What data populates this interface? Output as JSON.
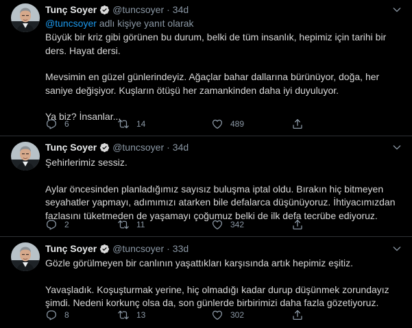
{
  "tweets": [
    {
      "name": "Tunç Soyer",
      "handle": "@tuncsoyer",
      "separator": "·",
      "time": "34d",
      "reply_mention": "@tuncsoyer",
      "reply_suffix": " adlı kişiye yanıt olarak",
      "paragraphs": [
        "Büyük bir kriz gibi görünen bu durum, belki de tüm insanlık, hepimiz için tarihi bir ders. Hayat dersi.",
        "Mevsimin en güzel günlerindeyiz. Ağaçlar bahar dallarına bürünüyor, doğa, her saniye değişiyor. Kuşların ötüşü her zamankinden daha iyi duyuluyor.",
        "Ya biz? İnsanlar..."
      ],
      "replies": "6",
      "retweets": "14",
      "likes": "489"
    },
    {
      "name": "Tunç Soyer",
      "handle": "@tuncsoyer",
      "separator": "·",
      "time": "34d",
      "paragraphs": [
        "Şehirlerimiz sessiz.",
        "Aylar öncesinden planladığımız sayısız buluşma iptal oldu. Bırakın hiç bitmeyen seyahatler yapmayı, adımımızı atarken bile defalarca düşünüyoruz. İhtiyacımızdan fazlasını tüketmeden de yaşamayı çoğumuz belki de ilk defa tecrübe ediyoruz."
      ],
      "replies": "2",
      "retweets": "11",
      "likes": "342"
    },
    {
      "name": "Tunç Soyer",
      "handle": "@tuncsoyer",
      "separator": "·",
      "time": "33d",
      "paragraphs": [
        "Gözle görülmeyen bir canlının yaşattıkları karşısında artık hepimiz eşitiz.",
        "Yavaşladık. Koşuşturmak yerine, hiç olmadığı kadar durup düşünmek zorundayız şimdi. Nedeni korkunç olsa da, son günlerde birbirimizi daha fazla gözetiyoruz."
      ],
      "replies": "8",
      "retweets": "13",
      "likes": "302"
    }
  ],
  "colors": {
    "background": "#000000",
    "text": "#d9d9d9",
    "muted": "#8b98a5",
    "link": "#1d9bf0",
    "verified": "#d9d9d9",
    "divider": "#2f3336"
  },
  "icons": [
    "avatar",
    "verified-icon",
    "chevron-down-icon",
    "reply-icon",
    "retweet-icon",
    "like-icon",
    "share-icon"
  ]
}
